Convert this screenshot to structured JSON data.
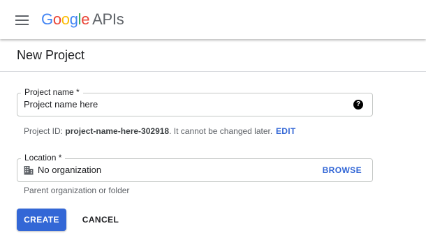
{
  "header": {
    "menu_icon": "hamburger-menu-icon",
    "logo": {
      "letters": [
        "G",
        "o",
        "o",
        "g",
        "l",
        "e"
      ],
      "suffix": "APIs",
      "colors": [
        "#4285f4",
        "#ea4335",
        "#fbbc05",
        "#4285f4",
        "#34a853",
        "#ea4335"
      ]
    }
  },
  "page": {
    "title": "New Project"
  },
  "form": {
    "project_name": {
      "label": "Project name *",
      "value": "Project name here",
      "help_icon": "help-circle-icon",
      "help_glyph": "?"
    },
    "project_id": {
      "prefix": "Project ID: ",
      "id": "project-name-here-302918",
      "suffix": ". It cannot be changed later.",
      "edit_label": "EDIT"
    },
    "location": {
      "label": "Location *",
      "icon": "building-icon",
      "value": "No organization",
      "browse_label": "BROWSE",
      "hint": "Parent organization or folder"
    }
  },
  "actions": {
    "create_label": "CREATE",
    "cancel_label": "CANCEL"
  },
  "colors": {
    "accent": "#3367d6",
    "border": "#c4c7c5",
    "hint_text": "#5f6368"
  }
}
